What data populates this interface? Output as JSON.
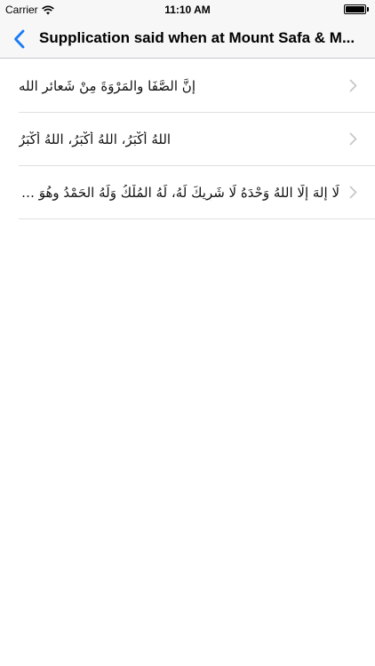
{
  "status_bar": {
    "carrier": "Carrier",
    "time": "11:10 AM"
  },
  "nav": {
    "title": "Supplication said when at Mount Safa & M...",
    "back_icon": "chevron-left-icon",
    "accent_color": "#1a7cf5"
  },
  "list": {
    "items": [
      {
        "text": "إِنَّ الصَّفَا والمَرْوَةَ مِنْ شَعائرِ الله"
      },
      {
        "text": "اللهُ أَكْبَرُ، اللهُ أَكْبَرُ، اللهُ أَكْبَرُ"
      },
      {
        "text": "لَا إلهَ إلَّا اللهُ وَحْدَهُ لَا شَرِيكَ لَهُ، لَهُ المُلْكُ وَلَهُ الحَمْدُ وهُوَ عَلى كُلِّ شَيْءٍ قَدِيرٌ"
      }
    ],
    "chevron_icon": "chevron-right-icon"
  }
}
